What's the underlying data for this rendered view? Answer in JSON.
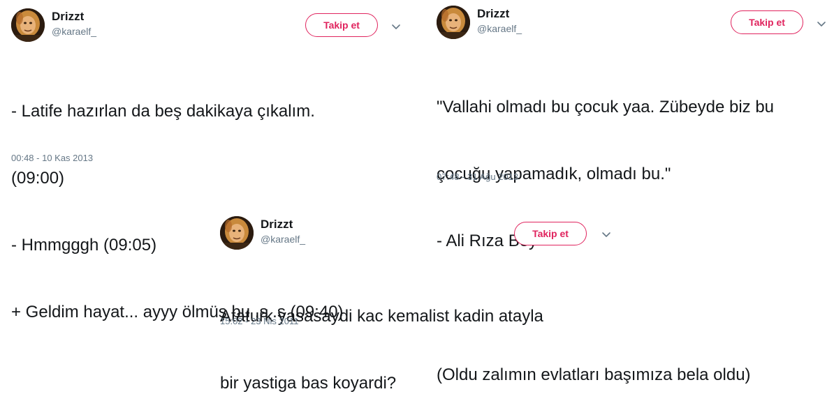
{
  "tweets": [
    {
      "author": "Drizzt",
      "handle": "@karaelf_",
      "follow_label": "Takip et",
      "lines": [
        "- Latife hazırlan da beş dakikaya çıkalım.",
        "(09:00)",
        "- Hmmgggh (09:05)",
        "+ Geldim hayat... ayyy ölmüş bu .s .s (09:40)"
      ],
      "timestamp": "00:48 - 10 Kas 2013"
    },
    {
      "author": "Drizzt",
      "handle": "@karaelf_",
      "follow_label": "Takip et",
      "lines": [
        "\"Vallahi olmadı bu çocuk yaa. Zübeyde biz bu",
        "çocuğu yapamadık, olmadı bu.\"",
        "- Ali Rıza Bey",
        "",
        "(Oldu zalımın evlatları başımıza bela oldu)"
      ],
      "timestamp": "07:48 - 31 Ağu 2013"
    },
    {
      "author": "Drizzt",
      "handle": "@karaelf_",
      "follow_label": "Takip et",
      "lines": [
        "Ataturk yasasaydi kac kemalist kadin atayla",
        "bir yastiga bas koyardi?"
      ],
      "timestamp": "15:02 - 23 Nis 2011"
    }
  ],
  "colors": {
    "follow_accent": "#e0245e",
    "secondary_text": "#657786",
    "primary_text": "#14171a"
  },
  "icons": {
    "avatar": "avatar-image",
    "caret": "chevron-down-icon"
  }
}
